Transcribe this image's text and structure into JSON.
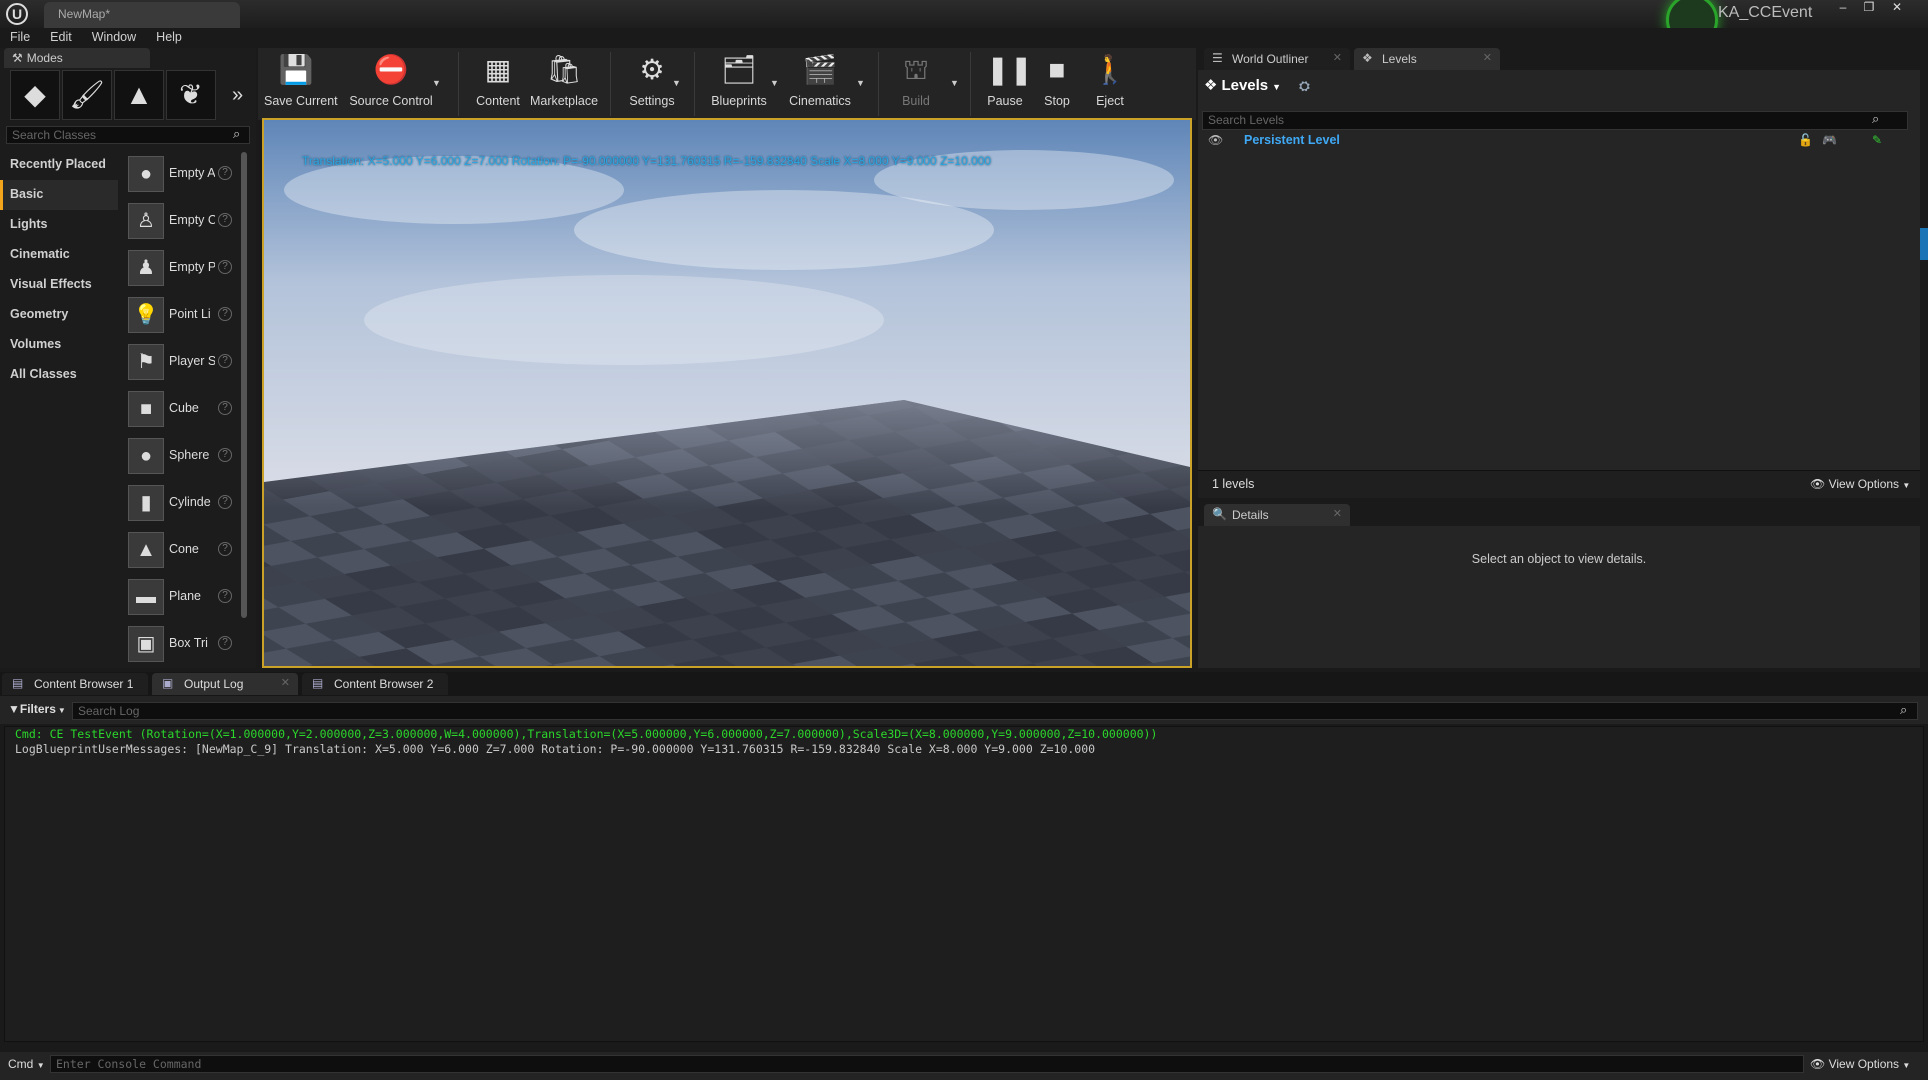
{
  "titlebar": {
    "doc_tab": "NewMap*",
    "project": "KA_CCEvent",
    "win_min": "–",
    "win_restore": "❐",
    "win_close": "✕"
  },
  "menu": [
    "File",
    "Edit",
    "Window",
    "Help"
  ],
  "modes": {
    "tab_label": "Modes",
    "search_placeholder": "Search Classes",
    "categories": [
      "Recently Placed",
      "Basic",
      "Lights",
      "Cinematic",
      "Visual Effects",
      "Geometry",
      "Volumes",
      "All Classes"
    ],
    "active_category": "Basic",
    "items": [
      {
        "label": "Empty A",
        "icon": "sphere-icon"
      },
      {
        "label": "Empty C",
        "icon": "character-icon"
      },
      {
        "label": "Empty P",
        "icon": "pawn-icon"
      },
      {
        "label": "Point Li",
        "icon": "lightbulb-icon"
      },
      {
        "label": "Player S",
        "icon": "player-start-icon"
      },
      {
        "label": "Cube",
        "icon": "cube-icon"
      },
      {
        "label": "Sphere",
        "icon": "sphere-icon"
      },
      {
        "label": "Cylinde",
        "icon": "cylinder-icon"
      },
      {
        "label": "Cone",
        "icon": "cone-icon"
      },
      {
        "label": "Plane",
        "icon": "plane-icon"
      },
      {
        "label": "Box Tri",
        "icon": "box-trigger-icon"
      }
    ]
  },
  "toolbar": {
    "save_current": "Save Current",
    "source_control": "Source Control",
    "content": "Content",
    "marketplace": "Marketplace",
    "settings": "Settings",
    "blueprints": "Blueprints",
    "cinematics": "Cinematics",
    "build": "Build",
    "pause": "Pause",
    "stop": "Stop",
    "eject": "Eject"
  },
  "viewport": {
    "overlay_text": "Translation: X=5.000 Y=6.000 Z=7.000 Rotation: P=-90.000000 Y=131.760315 R=-159.832840 Scale X=8.000 Y=9.000 Z=10.000"
  },
  "right_tabs": {
    "world_outliner": "World Outliner",
    "levels": "Levels"
  },
  "levels": {
    "header": "Levels",
    "search_placeholder": "Search Levels",
    "persistent": "Persistent Level",
    "count": "1 levels",
    "view_options": "View Options"
  },
  "details": {
    "tab": "Details",
    "empty_message": "Select an object to view details."
  },
  "bottom_tabs": [
    "Content Browser 1",
    "Output Log",
    "Content Browser 2"
  ],
  "log": {
    "filters": "Filters",
    "search_placeholder": "Search Log",
    "lines": [
      {
        "text": "Cmd: CE TestEvent (Rotation=(X=1.000000,Y=2.000000,Z=3.000000,W=4.000000),Translation=(X=5.000000,Y=6.000000,Z=7.000000),Scale3D=(X=8.000000,Y=9.000000,Z=10.000000))",
        "color": "#2bd72b"
      },
      {
        "text": "LogBlueprintUserMessages: [NewMap_C_9] Translation: X=5.000 Y=6.000 Z=7.000 Rotation: P=-90.000000 Y=131.760315 R=-159.832840 Scale X=8.000 Y=9.000 Z=10.000",
        "color": "#c8c8c8"
      }
    ]
  },
  "console": {
    "cmd_label": "Cmd",
    "placeholder": "Enter Console Command",
    "view_options": "View Options"
  },
  "colors": {
    "accent": "#f3a51c",
    "link": "#3fa9f5",
    "log_cmd": "#2bd72b"
  }
}
